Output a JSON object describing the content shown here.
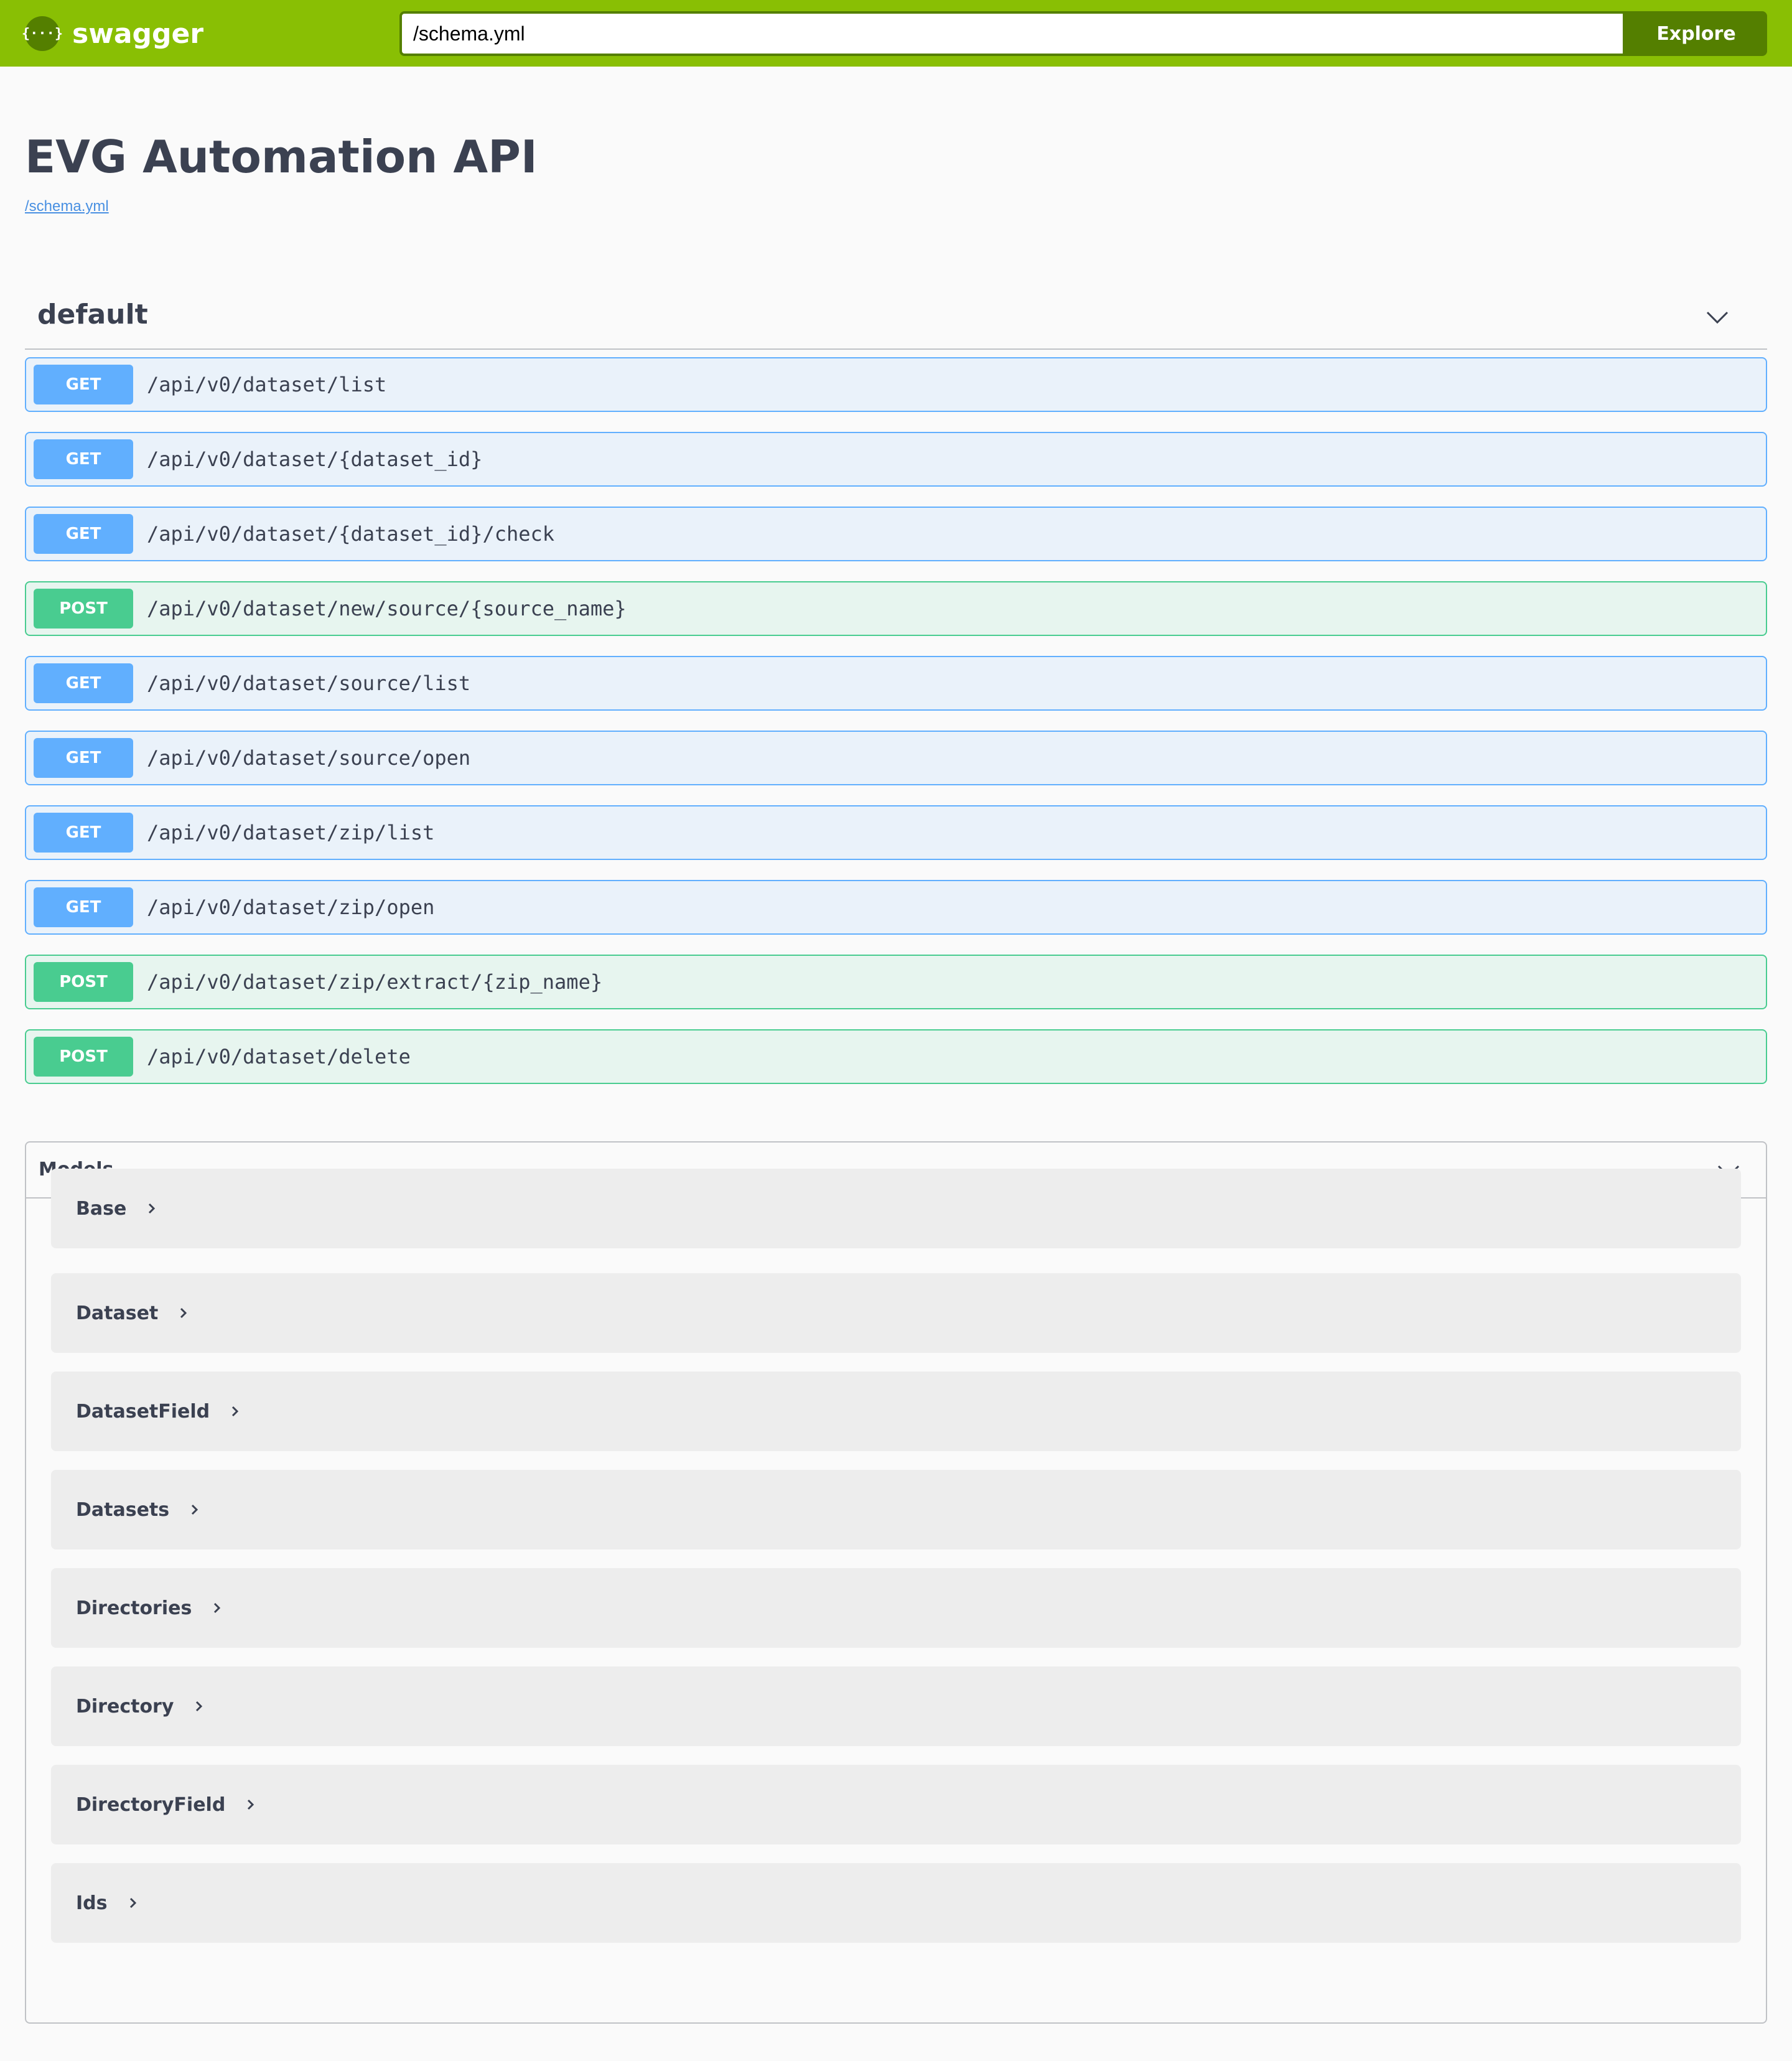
{
  "topbar": {
    "logo_glyph": "{···}",
    "logo_text": "swagger",
    "url_value": "/schema.yml",
    "explore_label": "Explore",
    "colors": {
      "bar": "#89bf04",
      "dark": "#547f00"
    }
  },
  "info": {
    "title": "EVG Automation API",
    "spec_link": "/schema.yml"
  },
  "tag": {
    "name": "default",
    "operations": [
      {
        "method": "GET",
        "path": "/api/v0/dataset/list"
      },
      {
        "method": "GET",
        "path": "/api/v0/dataset/{dataset_id}"
      },
      {
        "method": "GET",
        "path": "/api/v0/dataset/{dataset_id}/check"
      },
      {
        "method": "POST",
        "path": "/api/v0/dataset/new/source/{source_name}"
      },
      {
        "method": "GET",
        "path": "/api/v0/dataset/source/list"
      },
      {
        "method": "GET",
        "path": "/api/v0/dataset/source/open"
      },
      {
        "method": "GET",
        "path": "/api/v0/dataset/zip/list"
      },
      {
        "method": "GET",
        "path": "/api/v0/dataset/zip/open"
      },
      {
        "method": "POST",
        "path": "/api/v0/dataset/zip/extract/{zip_name}"
      },
      {
        "method": "POST",
        "path": "/api/v0/dataset/delete"
      }
    ]
  },
  "models": {
    "title": "Models",
    "items": [
      {
        "name": "Base"
      },
      {
        "name": "Dataset"
      },
      {
        "name": "DatasetField"
      },
      {
        "name": "Datasets"
      },
      {
        "name": "Directories"
      },
      {
        "name": "Directory"
      },
      {
        "name": "DirectoryField"
      },
      {
        "name": "Ids"
      }
    ]
  },
  "colors": {
    "get": "#61affe",
    "post": "#49cc90",
    "text": "#3b4151",
    "link": "#4990e2"
  }
}
